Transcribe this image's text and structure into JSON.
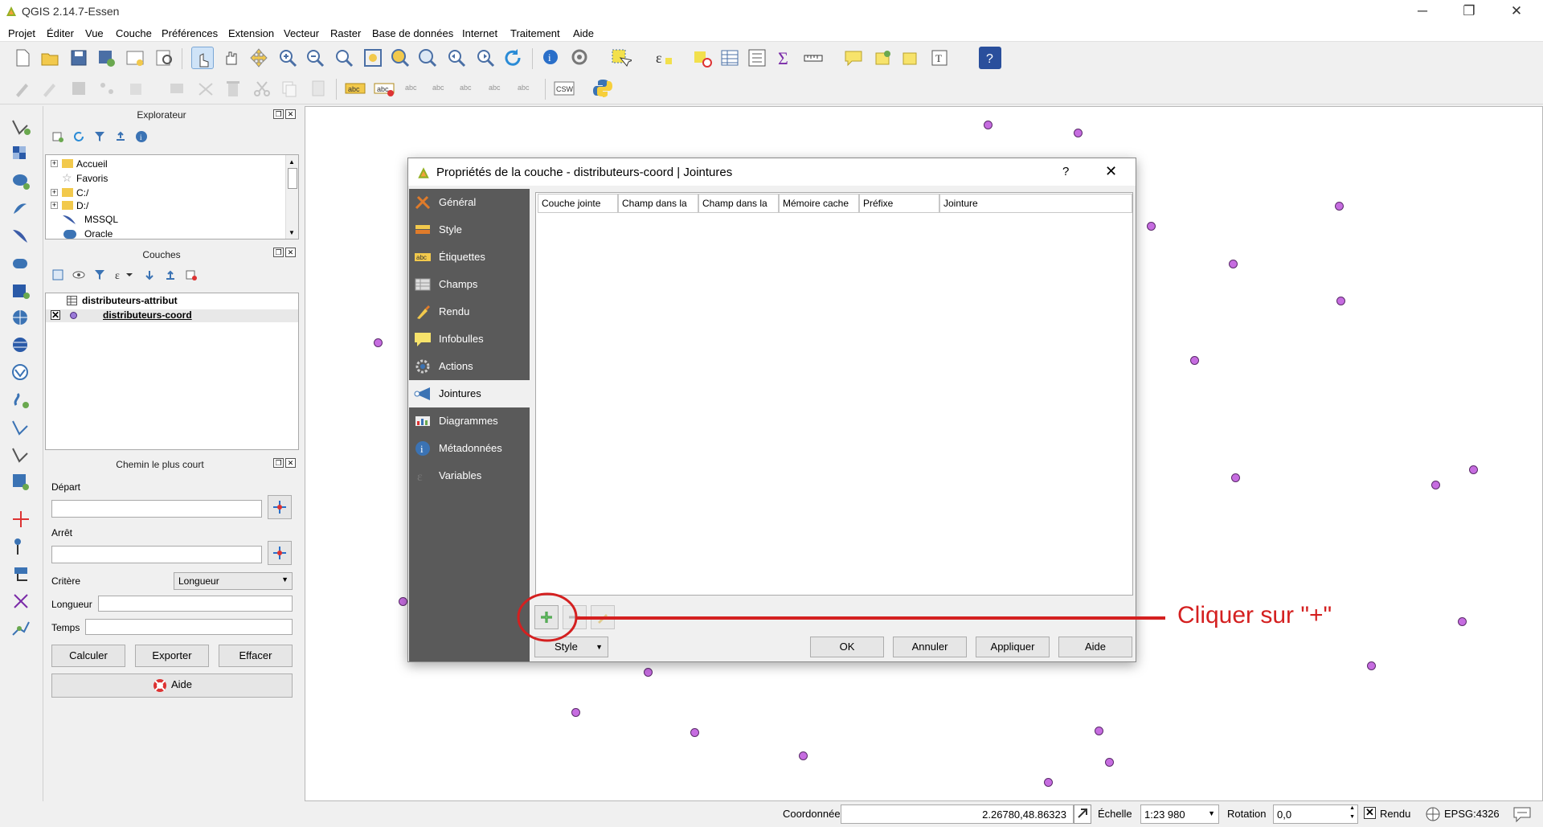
{
  "window": {
    "title": "QGIS 2.14.7-Essen",
    "controls": [
      "─",
      "❐",
      "✕"
    ]
  },
  "menu": [
    "Projet",
    "Éditer",
    "Vue",
    "Couche",
    "Préférences",
    "Extension",
    "Vecteur",
    "Raster",
    "Base de données",
    "Internet",
    "Traitement",
    "Aide"
  ],
  "toolbar2": {
    "csw_label": "CSW",
    "abc_label": "abc"
  },
  "explorer": {
    "title": "Explorateur",
    "items": [
      "Accueil",
      "Favoris",
      "C:/",
      "D:/",
      "MSSQL",
      "Oracle"
    ]
  },
  "layers": {
    "title": "Couches",
    "items": [
      "distributeurs-attribut",
      "distributeurs-coord"
    ]
  },
  "shortest_path": {
    "title": "Chemin le plus court",
    "depart_label": "Départ",
    "arret_label": "Arrêt",
    "critere_label": "Critère",
    "critere_value": "Longueur",
    "longueur_label": "Longueur",
    "temps_label": "Temps",
    "calculer": "Calculer",
    "exporter": "Exporter",
    "effacer": "Effacer",
    "aide": "Aide"
  },
  "dialog": {
    "title": "Propriétés de la couche - distributeurs-coord | Jointures",
    "help": "?",
    "close": "✕",
    "sidebar": [
      "Général",
      "Style",
      "Étiquettes",
      "Champs",
      "Rendu",
      "Infobulles",
      "Actions",
      "Jointures",
      "Diagrammes",
      "Métadonnées",
      "Variables"
    ],
    "active_index": 7,
    "columns": [
      "Couche jointe",
      "Champ dans la",
      "Champ dans la",
      "Mémoire cache",
      "Préfixe",
      "Jointure"
    ],
    "style_button": "Style",
    "ok": "OK",
    "annuler": "Annuler",
    "appliquer": "Appliquer",
    "aide": "Aide"
  },
  "annotation": {
    "text": "Cliquer sur \"+\"",
    "color": "#d42020"
  },
  "status": {
    "coord_label": "Coordonnée",
    "coord_value": "2.26780,48.86323",
    "scale_label": "Échelle",
    "scale_value": "1:23 980",
    "rotation_label": "Rotation",
    "rotation_value": "0,0",
    "render_label": "Rendu",
    "crs": "EPSG:4326"
  },
  "colors": {
    "point_fill": "#c66ce0",
    "sidebar_bg": "#5a5a5a",
    "annotation": "#d42020"
  }
}
